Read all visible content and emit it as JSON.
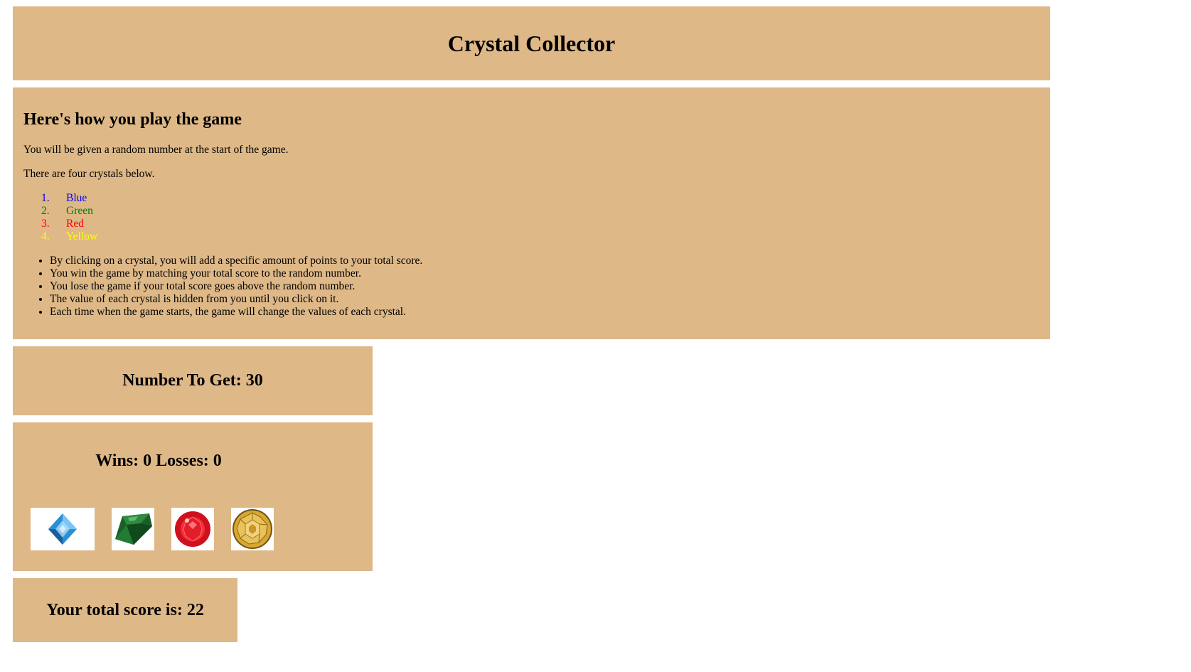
{
  "header": {
    "title": "Crystal Collector"
  },
  "instructions": {
    "heading": "Here's how you play the game",
    "intro": "You will be given a random number at the start of the game.",
    "crystals_intro": "There are four crystals below.",
    "crystal_list": [
      {
        "num": "1.",
        "label": "Blue",
        "color": "#0000ff"
      },
      {
        "num": "2.",
        "label": "Green",
        "color": "#008000"
      },
      {
        "num": "3.",
        "label": "Red",
        "color": "#ff0000"
      },
      {
        "num": "4.",
        "label": "Yellow",
        "color": "#ffff00"
      }
    ],
    "rules": [
      "By clicking on a crystal, you will add a specific amount of points to your total score.",
      "You win the game by matching your total score to the random number.",
      "You lose the game if your total score goes above the random number.",
      "The value of each crystal is hidden from you until you click on it.",
      "Each time when the game starts, the game will change the values of each crystal."
    ]
  },
  "game": {
    "target_label": "Number To Get: 30",
    "record_label": "Wins: 0 Losses: 0",
    "crystals": [
      {
        "name": "blue-crystal-icon",
        "color": "#3a9ad9"
      },
      {
        "name": "green-crystal-icon",
        "color": "#1f6b2f"
      },
      {
        "name": "red-crystal-icon",
        "color": "#e0141e"
      },
      {
        "name": "yellow-crystal-icon",
        "color": "#d9a72f"
      }
    ],
    "score_label": "Your total score is: 22"
  },
  "colors": {
    "panel_bg": "#deb887",
    "page_bg": "#ffffff"
  }
}
